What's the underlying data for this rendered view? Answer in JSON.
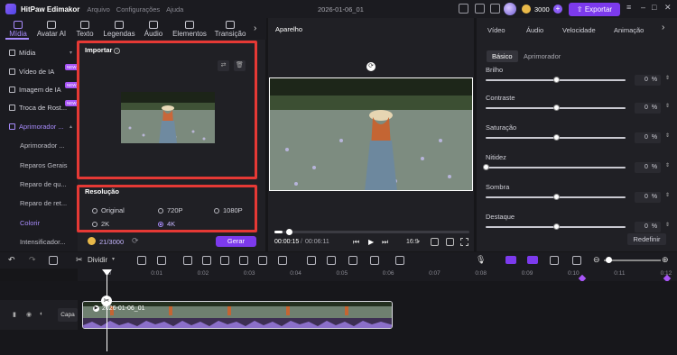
{
  "titlebar": {
    "app_name": "HitPaw Edimakor",
    "menus": [
      "Arquivo",
      "Configurações",
      "Ajuda"
    ],
    "project_name": "2026-01-06_01",
    "credits": "3000",
    "export_label": "Exportar"
  },
  "tabs": [
    {
      "label": "Mídia",
      "icon": "media-icon",
      "active": true
    },
    {
      "label": "Avatar AI",
      "icon": "avatar-icon"
    },
    {
      "label": "Texto",
      "icon": "text-icon"
    },
    {
      "label": "Legendas",
      "icon": "subtitle-icon"
    },
    {
      "label": "Áudio",
      "icon": "audio-icon"
    },
    {
      "label": "Elementos",
      "icon": "elements-icon"
    },
    {
      "label": "Transição",
      "icon": "transition-icon"
    }
  ],
  "sidebar": {
    "items": [
      {
        "label": "Mídia"
      },
      {
        "label": "Vídeo de IA",
        "badge": "NEW"
      },
      {
        "label": "Imagem de IA",
        "badge": "NEW"
      },
      {
        "label": "Troca de Rost...",
        "badge": "NEW"
      },
      {
        "label": "Aprimorador ...",
        "expanded": true
      }
    ],
    "subitems": [
      {
        "label": "Aprimorador ..."
      },
      {
        "label": "Reparos Gerais"
      },
      {
        "label": "Reparo de qu..."
      },
      {
        "label": "Reparo de ret..."
      },
      {
        "label": "Colorir",
        "selected": true
      },
      {
        "label": "Intensificador..."
      }
    ]
  },
  "import": {
    "title": "Importar"
  },
  "resolution": {
    "title": "Resolução",
    "options": [
      {
        "label": "Original"
      },
      {
        "label": "720P"
      },
      {
        "label": "1080P"
      },
      {
        "label": "2K"
      },
      {
        "label": "4K",
        "selected": true
      }
    ]
  },
  "generate": {
    "credits": "21/3000",
    "button": "Gerar"
  },
  "player": {
    "title": "Aparelho",
    "time_current": "00:00:15",
    "time_total": "00:06:11",
    "aspect": "16:9",
    "progress": 0.04
  },
  "adjust": {
    "tabs": [
      "Vídeo",
      "Áudio",
      "Velocidade",
      "Animação"
    ],
    "subtabs": [
      "Básico",
      "Aprimorador"
    ],
    "sliders": [
      {
        "label": "Brilho",
        "value": "0",
        "unit": "%",
        "level": 0.5
      },
      {
        "label": "Contraste",
        "value": "0",
        "unit": "%",
        "level": 0.5
      },
      {
        "label": "Saturação",
        "value": "0",
        "unit": "%",
        "level": 0.5
      },
      {
        "label": "Nitidez",
        "value": "0",
        "unit": "%",
        "level": 0.0
      },
      {
        "label": "Sombra",
        "value": "0",
        "unit": "%",
        "level": 0.5
      },
      {
        "label": "Destaque",
        "value": "0",
        "unit": "%",
        "level": 0.5
      }
    ],
    "reset": "Redefinir"
  },
  "toolbar": {
    "split_label": "Dividir"
  },
  "ruler": [
    "00",
    "0:01",
    "0:02",
    "0:03",
    "0:04",
    "0:05",
    "0:06",
    "0:07",
    "0:08",
    "0:09",
    "0:10",
    "0:11",
    "0:12"
  ],
  "track": {
    "cover_label": "Capa",
    "clip_name": "2026-01-06_01"
  }
}
